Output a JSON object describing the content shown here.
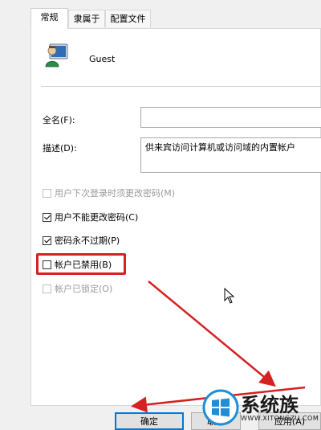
{
  "tabs": [
    {
      "label": "常规",
      "active": true
    },
    {
      "label": "隶属于",
      "active": false
    },
    {
      "label": "配置文件",
      "active": false
    }
  ],
  "user": {
    "icon": "user-account-icon",
    "name": "Guest"
  },
  "fields": {
    "fullname_label": "全名(F):",
    "fullname_value": "",
    "description_label": "描述(D):",
    "description_value": "供来宾访问计算机或访问域的内置帐户"
  },
  "checkboxes": [
    {
      "label": "用户下次登录时须更改密码(M)",
      "checked": false,
      "disabled": true
    },
    {
      "label": "用户不能更改密码(C)",
      "checked": true,
      "disabled": false
    },
    {
      "label": "密码永不过期(P)",
      "checked": true,
      "disabled": false
    },
    {
      "label": "帐户已禁用(B)",
      "checked": false,
      "disabled": false
    },
    {
      "label": "帐户已锁定(O)",
      "checked": false,
      "disabled": true
    }
  ],
  "buttons": {
    "ok": "确定",
    "cancel": "取消",
    "apply": "应用(A)"
  },
  "watermark": {
    "text": "系统族",
    "url": "WWW.XITONGZU.COM"
  },
  "colors": {
    "highlight": "#d42121",
    "arrow": "#d42121",
    "focus_border": "#0078d7"
  }
}
